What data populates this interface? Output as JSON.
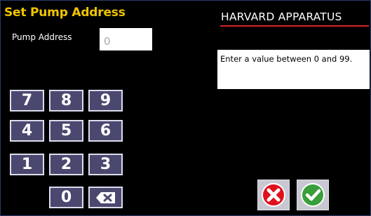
{
  "screen": {
    "title": "Set Pump Address",
    "brand": "HARVARD APPARATUS"
  },
  "pump_address": {
    "label": "Pump Address",
    "value": "0"
  },
  "message": "Enter a value between 0 and 99.",
  "keypad": {
    "k7": "7",
    "k8": "8",
    "k9": "9",
    "k4": "4",
    "k5": "5",
    "k6": "6",
    "k1": "1",
    "k2": "2",
    "k3": "3",
    "k0": "0",
    "backspace_icon": "backspace-icon"
  },
  "actions": {
    "cancel_icon": "cancel-x-icon",
    "confirm_icon": "checkmark-icon"
  },
  "colors": {
    "title": "#f0c400",
    "brand_underline": "#d8202a",
    "key_fill": "#4b4870",
    "cancel": "#e0101c",
    "confirm": "#3a9e3a"
  }
}
